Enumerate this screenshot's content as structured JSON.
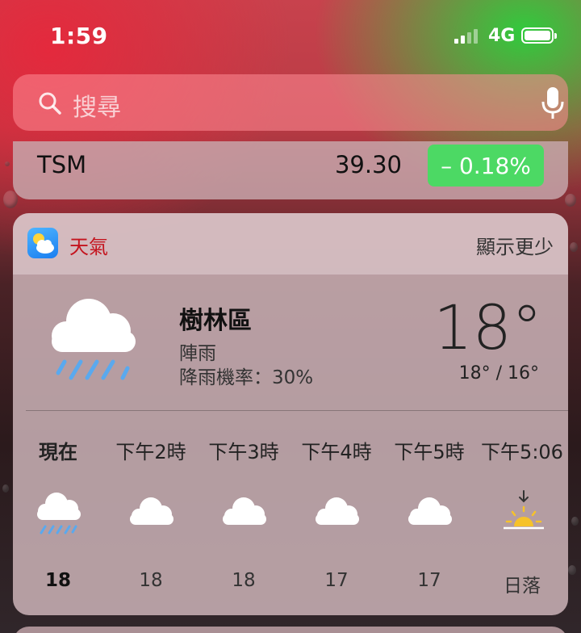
{
  "status_bar": {
    "time": "1:59",
    "network": "4G"
  },
  "search": {
    "placeholder": "搜尋"
  },
  "stock": {
    "symbol": "TSM",
    "price": "39.30",
    "change": "– 0.18%",
    "change_color": "#4cd964"
  },
  "weather": {
    "app_name": "天氣",
    "show_less": "顯示更少",
    "location": "樹林區",
    "condition": "陣雨",
    "rain_chance": "降雨機率：30%",
    "current_temp": "18°",
    "high_low": "18° / 16°",
    "hourly": [
      {
        "label": "現在",
        "icon": "rain-cloud-icon",
        "temp": "18"
      },
      {
        "label": "下午2時",
        "icon": "cloud-icon",
        "temp": "18"
      },
      {
        "label": "下午3時",
        "icon": "cloud-icon",
        "temp": "18"
      },
      {
        "label": "下午4時",
        "icon": "cloud-icon",
        "temp": "17"
      },
      {
        "label": "下午5時",
        "icon": "cloud-icon",
        "temp": "17"
      },
      {
        "label": "下午5:06",
        "icon": "sunset-icon",
        "temp": "日落"
      }
    ]
  }
}
